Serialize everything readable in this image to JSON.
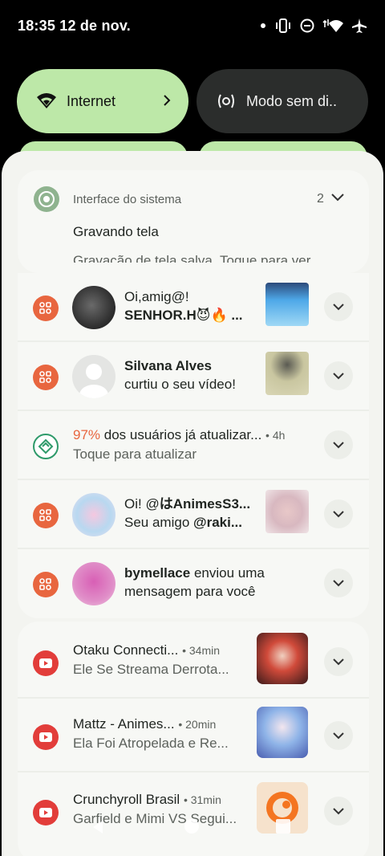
{
  "status": {
    "time": "18:35 12 de nov."
  },
  "tiles": {
    "internet_label": "Internet",
    "dnd_label": "Modo sem di.."
  },
  "system_group": {
    "app_name": "Interface do sistema",
    "count": "2",
    "title": "Gravando tela",
    "body": "Gravação de tela salva. Toque para ver"
  },
  "notifications": [
    {
      "line1": "Oi,amig@!",
      "line2": "SENHOR.H😈🔥 ..."
    },
    {
      "line1": "Silvana Alves",
      "line2": "curtiu o seu vídeo!"
    },
    {
      "percent": "97%",
      "line1_rest": " dos usuários já atualizar...",
      "time": "• 4h",
      "line2": "Toque para atualizar"
    },
    {
      "line1_prefix": "Oi! @",
      "line1_bold": "はAnimesS3...",
      "line2_prefix": "Seu amigo ",
      "line2_bold": "@raki..."
    },
    {
      "line1_bold": "bymellace",
      "line1_rest": " enviou uma",
      "line2": "mensagem para você"
    }
  ],
  "youtube": [
    {
      "channel": "Otaku Connecti...",
      "time": "• 34min",
      "title": "Ele Se Streama Derrota..."
    },
    {
      "channel": "Mattz - Animes...",
      "time": "• 20min",
      "title": "Ela Foi Atropelada e Re..."
    },
    {
      "channel": "Crunchyroll Brasil",
      "time": "• 31min",
      "title": "Garfield e Mimi VS Segui..."
    }
  ],
  "colors": {
    "tile_active": "#bde8a8",
    "tile_inactive": "#2b2d2c",
    "app_orange": "#e8663f",
    "app_green": "#2e9a6a",
    "youtube_red": "#e23d3a"
  },
  "icons": [
    "wifi-icon",
    "dnd-icon",
    "chevron-right-icon",
    "vibrate-icon",
    "minus-circle-icon",
    "data-arrows-icon",
    "airplane-icon",
    "system-ui-icon",
    "chevron-down-icon",
    "app-grid-icon",
    "update-icon",
    "youtube-icon"
  ]
}
